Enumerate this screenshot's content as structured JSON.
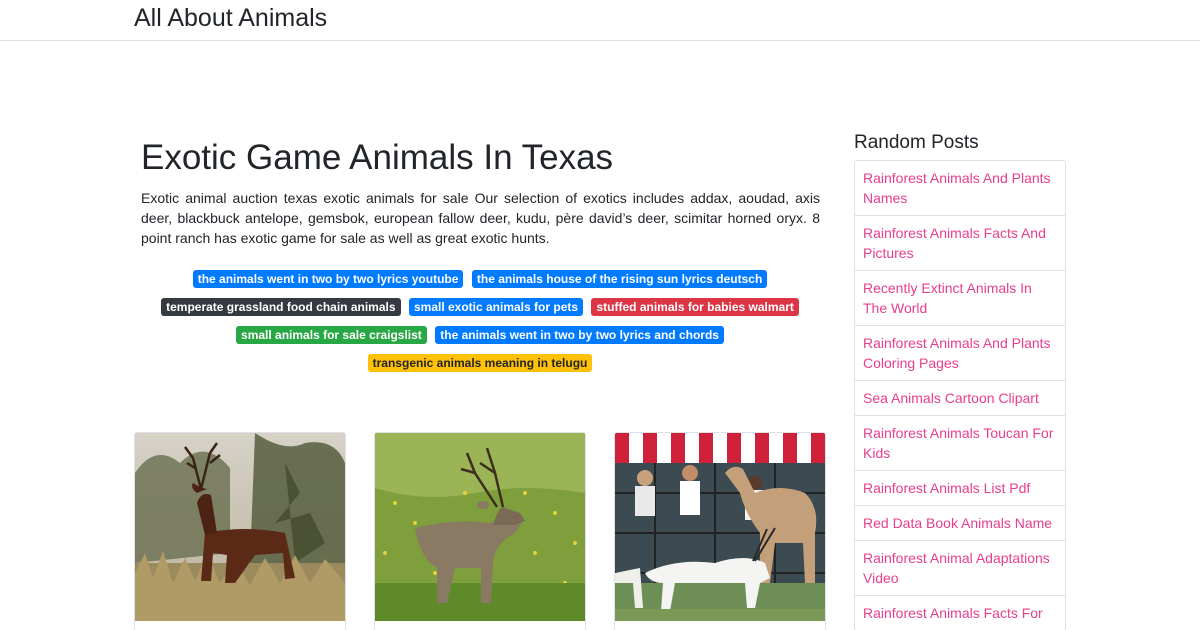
{
  "site": {
    "brand": "All About Animals"
  },
  "post": {
    "title": "Exotic Game Animals In Texas",
    "excerpt": "Exotic animal auction texas exotic animals for sale Our selection of exotics includes addax, aoudad, axis deer, blackbuck antelope, gemsbok, european fallow deer, kudu, père david’s deer, scimitar horned oryx. 8 point ranch has exotic game for sale as well as great exotic hunts."
  },
  "tags": [
    {
      "label": "the animals went in two by two lyrics youtube",
      "color": "#007bff"
    },
    {
      "label": "the animals house of the rising sun lyrics deutsch",
      "color": "#007bff"
    },
    {
      "label": "temperate grassland food chain animals",
      "color": "#343a40"
    },
    {
      "label": "small exotic animals for pets",
      "color": "#007bff"
    },
    {
      "label": "stuffed animals for babies walmart",
      "color": "#dc3545"
    },
    {
      "label": "small animals for sale craigslist",
      "color": "#28a745"
    },
    {
      "label": "the animals went in two by two lyrics and chords",
      "color": "#007bff"
    },
    {
      "label": "transgenic animals meaning in telugu",
      "color": "#ffc107"
    }
  ],
  "cards": [
    {
      "image": "red-stag-deer-photo"
    },
    {
      "image": "sambar-deer-photo"
    },
    {
      "image": "safari-tram-with-oryx-and-camel-photo"
    }
  ],
  "sidebar": {
    "title": "Random Posts",
    "items": [
      {
        "label": "Rainforest Animals And Plants Names"
      },
      {
        "label": "Rainforest Animals Facts And Pictures"
      },
      {
        "label": "Recently Extinct Animals In The World"
      },
      {
        "label": "Rainforest Animals And Plants Coloring Pages"
      },
      {
        "label": "Sea Animals Cartoon Clipart"
      },
      {
        "label": "Rainforest Animals Toucan For Kids"
      },
      {
        "label": "Rainforest Animals List Pdf"
      },
      {
        "label": "Red Data Book Animals Name"
      },
      {
        "label": "Rainforest Animal Adaptations Video"
      },
      {
        "label": "Rainforest Animals Facts For"
      }
    ]
  },
  "colors": {
    "link": "#e83e8c",
    "primary": "#007bff",
    "border": "#dee2e6",
    "text": "#212529"
  }
}
